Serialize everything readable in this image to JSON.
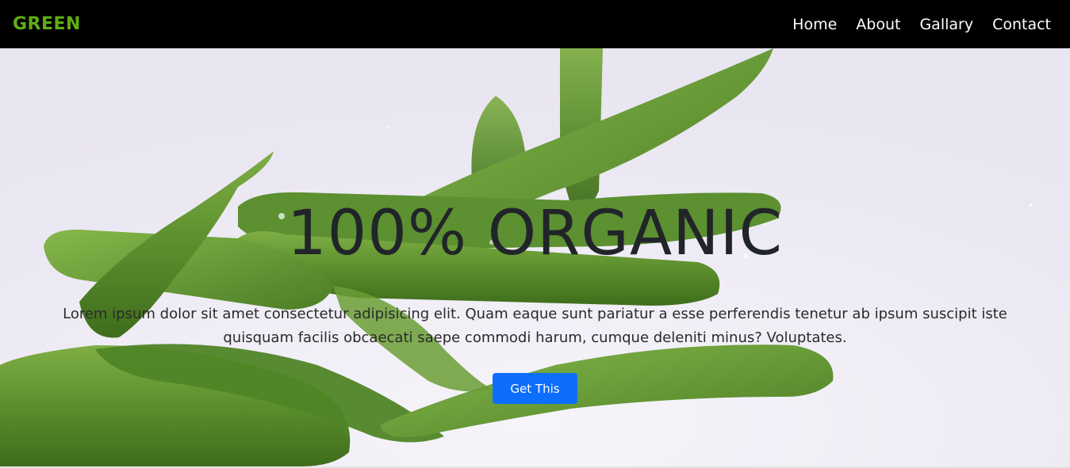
{
  "colors": {
    "brand": "#5fae13",
    "nav_bg": "#000000",
    "button_bg": "#0d6efd",
    "heading": "#212529"
  },
  "navbar": {
    "brand": "GREEN",
    "links": [
      {
        "label": "Home"
      },
      {
        "label": "About"
      },
      {
        "label": "Gallary"
      },
      {
        "label": "Contact"
      }
    ]
  },
  "hero": {
    "background_subject": "okra-icon",
    "title": "100% ORGANIC",
    "text": "Lorem ipsum dolor sit amet consectetur adipisicing elit. Quam eaque sunt pariatur a esse perferendis tenetur ab ipsum suscipit iste quisquam facilis obcaecati saepe commodi harum, cumque deleniti minus? Voluptates.",
    "button_label": "Get This"
  }
}
